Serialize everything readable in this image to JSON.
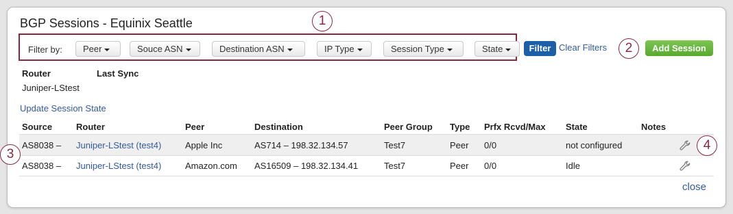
{
  "title": "BGP Sessions - Equinix Seattle",
  "callouts": [
    "1",
    "2",
    "3",
    "4"
  ],
  "filters": {
    "label": "Filter by:",
    "dropdowns": [
      "Peer",
      "Souce ASN",
      "Destination ASN",
      "IP Type",
      "Session Type",
      "State"
    ],
    "filter_button": "Filter",
    "clear_link": "Clear Filters"
  },
  "add_button": "Add Session",
  "router_info": {
    "router_header": "Router",
    "sync_header": "Last Sync",
    "router_value": "Juniper-LStest"
  },
  "update_link": "Update Session State",
  "table": {
    "headers": [
      "Source",
      "Router",
      "Peer",
      "Destination",
      "Peer Group",
      "Type",
      "Prfx Rcvd/Max",
      "State",
      "Notes"
    ],
    "rows": [
      {
        "source": "AS8038 –",
        "router": "Juniper-LStest (test4)",
        "peer": "Apple Inc",
        "destination": "AS714 – 198.32.134.57",
        "peer_group": "Test7",
        "type": "Peer",
        "prefix": "0/0",
        "state": "not configured",
        "notes": ""
      },
      {
        "source": "AS8038 –",
        "router": "Juniper-LStest (test4)",
        "peer": "Amazon.com",
        "destination": "AS16509 – 198.32.134.41",
        "peer_group": "Test7",
        "type": "Peer",
        "prefix": "0/0",
        "state": "Idle",
        "notes": ""
      }
    ]
  },
  "close_link": "close",
  "colors": {
    "accent_callout": "#8a2740",
    "filter_button": "#1b5fa8",
    "add_button": "#6bb841",
    "link": "#3359a0"
  }
}
